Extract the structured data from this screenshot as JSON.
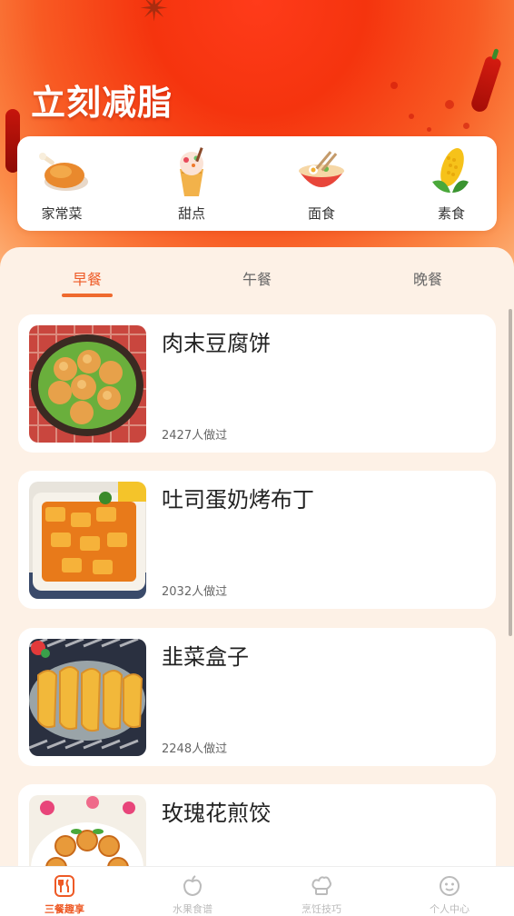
{
  "hero": {
    "title": "立刻减脂"
  },
  "categories": [
    {
      "label": "家常菜",
      "icon": "roast-chicken-icon"
    },
    {
      "label": "甜点",
      "icon": "ice-cream-icon"
    },
    {
      "label": "面食",
      "icon": "noodle-bowl-icon"
    },
    {
      "label": "素食",
      "icon": "corn-icon"
    }
  ],
  "meal_tabs": [
    {
      "label": "早餐",
      "active": true
    },
    {
      "label": "午餐",
      "active": false
    },
    {
      "label": "晚餐",
      "active": false
    }
  ],
  "recipes": [
    {
      "name": "肉末豆腐饼",
      "count": "2427人做过"
    },
    {
      "name": "吐司蛋奶烤布丁",
      "count": "2032人做过"
    },
    {
      "name": "韭菜盒子",
      "count": "2248人做过"
    },
    {
      "name": "玫瑰花煎饺",
      "count": ""
    }
  ],
  "tabbar": [
    {
      "label": "三餐趣享",
      "icon": "fork-knife-icon",
      "active": true
    },
    {
      "label": "水果食谱",
      "icon": "apple-icon",
      "active": false
    },
    {
      "label": "烹饪技巧",
      "icon": "chef-hat-icon",
      "active": false
    },
    {
      "label": "个人中心",
      "icon": "smiley-icon",
      "active": false
    }
  ],
  "colors": {
    "accent": "#ee5a26",
    "hero": "#f5340e",
    "bg": "#fdf1e6"
  }
}
